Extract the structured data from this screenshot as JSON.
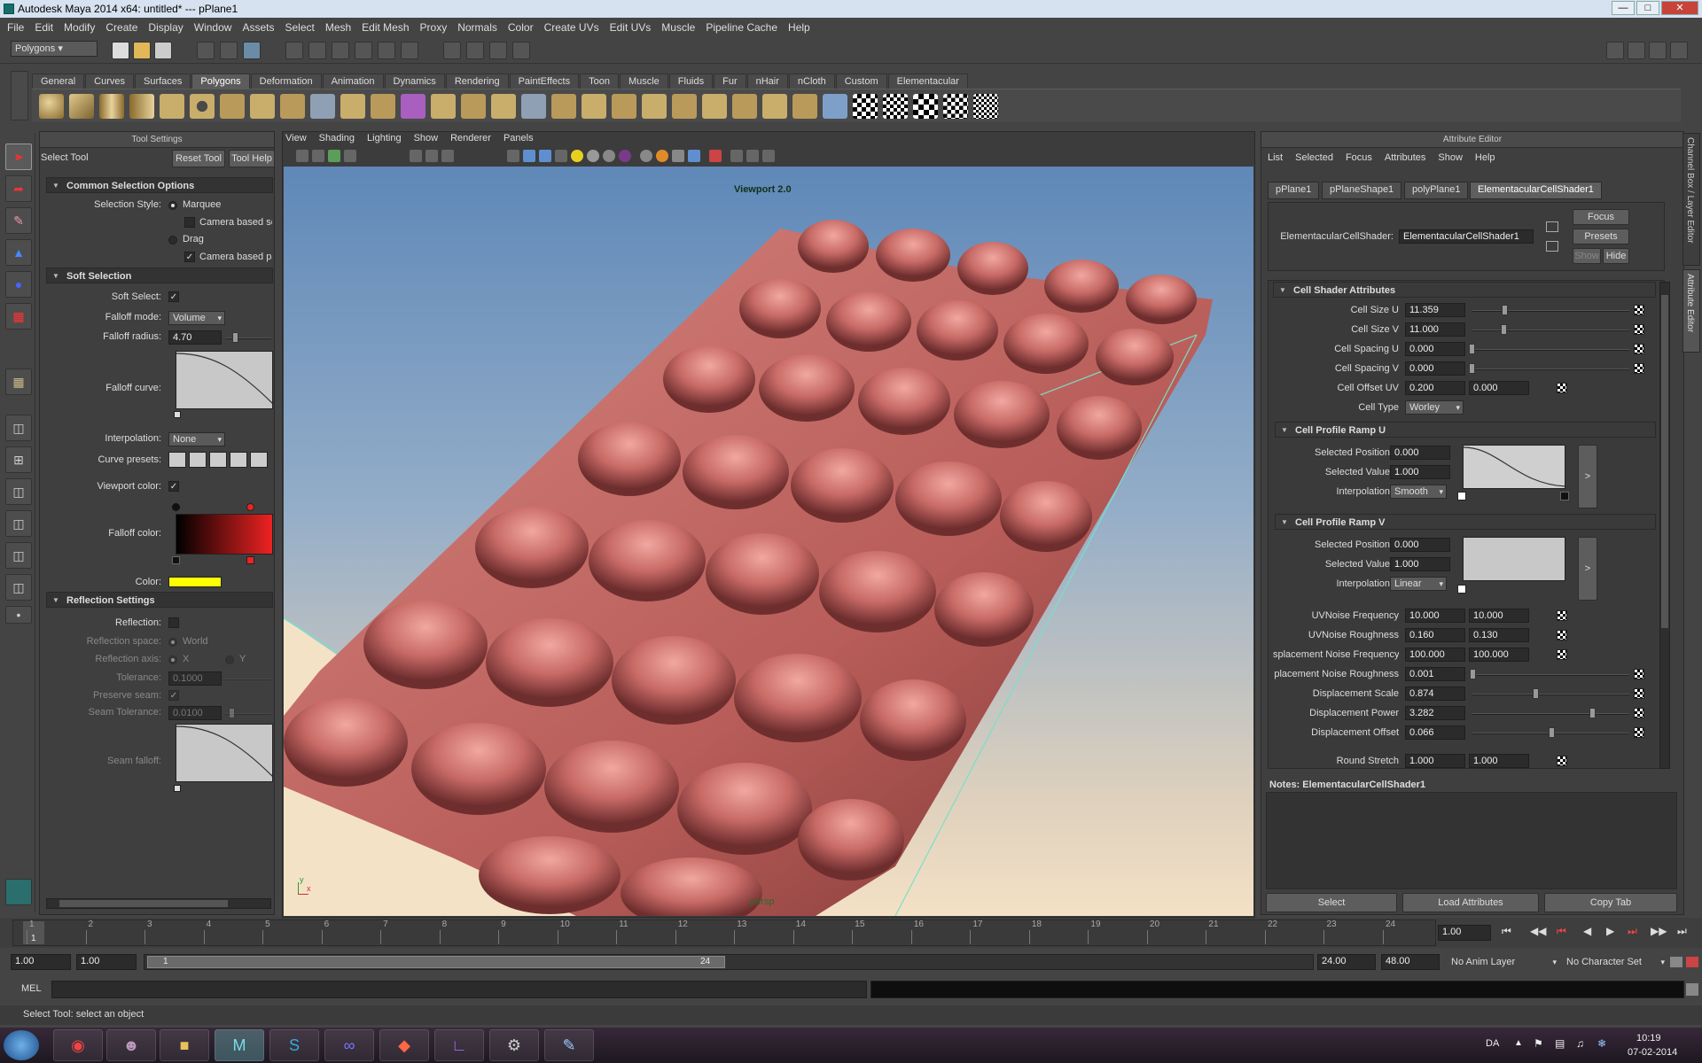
{
  "window": {
    "title": "Autodesk Maya 2014 x64: untitled*   ---   pPlane1"
  },
  "menubar": [
    "File",
    "Edit",
    "Modify",
    "Create",
    "Display",
    "Window",
    "Assets",
    "Select",
    "Mesh",
    "Edit Mesh",
    "Proxy",
    "Normals",
    "Color",
    "Create UVs",
    "Edit UVs",
    "Muscle",
    "Pipeline Cache",
    "Help"
  ],
  "mode_menu": "Polygons",
  "shelf_tabs": [
    "General",
    "Curves",
    "Surfaces",
    "Polygons",
    "Deformation",
    "Animation",
    "Dynamics",
    "Rendering",
    "PaintEffects",
    "Toon",
    "Muscle",
    "Fluids",
    "Fur",
    "nHair",
    "nCloth",
    "Custom",
    "Elementacular"
  ],
  "active_shelf": "Polygons",
  "tool_settings": {
    "header": "Tool Settings",
    "tool_name": "Select Tool",
    "reset_btn": "Reset Tool",
    "help_btn": "Tool Help",
    "common": {
      "title": "Common Selection Options",
      "style_label": "Selection Style:",
      "marquee": "Marquee",
      "camera_based_sel": "Camera based se",
      "drag": "Drag",
      "camera_based_paint": "Camera based pa"
    },
    "soft": {
      "title": "Soft Selection",
      "soft_select": "Soft Select:",
      "falloff_mode": "Falloff mode:",
      "falloff_mode_val": "Volume",
      "falloff_radius": "Falloff radius:",
      "falloff_radius_val": "4.70",
      "falloff_curve": "Falloff curve:",
      "interpolation": "Interpolation:",
      "interpolation_val": "None",
      "curve_presets": "Curve presets:",
      "viewport_color": "Viewport color:",
      "falloff_color": "Falloff color:",
      "color": "Color:",
      "color_hex": "#ffff00"
    },
    "reflection": {
      "title": "Reflection Settings",
      "reflection": "Reflection:",
      "space": "Reflection space:",
      "world": "World",
      "axis": "Reflection axis:",
      "x": "X",
      "y": "Y",
      "tolerance": "Tolerance:",
      "tolerance_val": "0.1000",
      "preserve": "Preserve seam:",
      "seam_tol": "Seam Tolerance:",
      "seam_tol_val": "0.0100",
      "seam_falloff": "Seam falloff:"
    }
  },
  "viewport": {
    "menus": [
      "View",
      "Shading",
      "Lighting",
      "Show",
      "Renderer",
      "Panels"
    ],
    "renderer_label": "Viewport 2.0",
    "camera": "persp",
    "axis_x": "x",
    "axis_y": "y",
    "mesh_color": "#c86a66"
  },
  "attr": {
    "header": "Attribute Editor",
    "menus": [
      "List",
      "Selected",
      "Focus",
      "Attributes",
      "Show",
      "Help"
    ],
    "tabs": [
      "pPlane1",
      "pPlaneShape1",
      "polyPlane1",
      "ElementacularCellShader1"
    ],
    "node_label": "ElementacularCellShader:",
    "node_value": "ElementacularCellShader1",
    "focus": "Focus",
    "presets": "Presets",
    "show": "Show",
    "hide": "Hide",
    "cell_title": "Cell Shader Attributes",
    "cell_size_u": "Cell Size U",
    "cell_size_u_val": "11.359",
    "cell_size_v": "Cell Size V",
    "cell_size_v_val": "11.000",
    "cell_spacing_u": "Cell Spacing U",
    "cell_spacing_u_val": "0.000",
    "cell_spacing_v": "Cell Spacing V",
    "cell_spacing_v_val": "0.000",
    "cell_offset": "Cell Offset UV",
    "cell_offset_a": "0.200",
    "cell_offset_b": "0.000",
    "cell_type": "Cell Type",
    "cell_type_val": "Worley",
    "rampu_title": "Cell Profile Ramp U",
    "rampv_title": "Cell Profile Ramp V",
    "sel_pos": "Selected Position",
    "sel_pos_val": "0.000",
    "sel_val": "Selected Value",
    "sel_val_val": "1.000",
    "interp": "Interpolation",
    "interp_u": "Smooth",
    "interp_v": "Linear",
    "arrow": ">",
    "uvnoise_freq": "UVNoise Frequency",
    "uvnoise_freq_a": "10.000",
    "uvnoise_freq_b": "10.000",
    "uvnoise_rough": "UVNoise Roughness",
    "uvnoise_rough_a": "0.160",
    "uvnoise_rough_b": "0.130",
    "disp_freq": "splacement Noise Frequency",
    "disp_freq_a": "100.000",
    "disp_freq_b": "100.000",
    "disp_rough": "placement Noise Roughness",
    "disp_rough_val": "0.001",
    "disp_scale": "Displacement Scale",
    "disp_scale_val": "0.874",
    "disp_power": "Displacement Power",
    "disp_power_val": "3.282",
    "disp_offset": "Displacement Offset",
    "disp_offset_val": "0.066",
    "round_stretch": "Round Stretch",
    "round_a": "1.000",
    "round_b": "1.000",
    "notes": "Notes:  ElementacularCellShader1",
    "select_btn": "Select",
    "load_btn": "Load Attributes",
    "copy_btn": "Copy Tab",
    "side_channel": "Channel Box / Layer Editor",
    "side_attr": "Attribute Editor"
  },
  "timeline": {
    "ticks": [
      "1",
      "2",
      "3",
      "4",
      "5",
      "6",
      "7",
      "8",
      "9",
      "10",
      "11",
      "12",
      "13",
      "14",
      "15",
      "16",
      "17",
      "18",
      "19",
      "20",
      "21",
      "22",
      "23",
      "24"
    ],
    "current": "1",
    "current_time": "1.00"
  },
  "range": {
    "start": "1.00",
    "start2": "1.00",
    "slider_start": "1",
    "slider_end": "24",
    "end": "24.00",
    "end2": "48.00",
    "anim_layer": "No Anim Layer",
    "char_set": "No Character Set"
  },
  "cmdline": {
    "label": "MEL"
  },
  "helpline": "Select Tool: select an object",
  "taskbar": {
    "lang": "DA",
    "time": "10:19",
    "date": "07-02-2014"
  }
}
